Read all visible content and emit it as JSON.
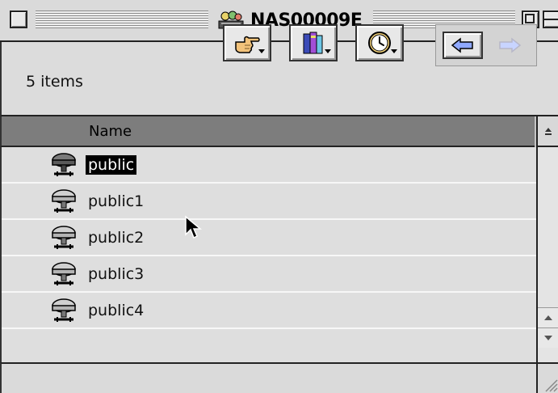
{
  "window": {
    "title": "NAS00009E"
  },
  "header": {
    "item_count": "5 items"
  },
  "toolbar": {
    "buttons": [
      {
        "icon": "pointing-hand-icon",
        "has_menu": true
      },
      {
        "icon": "books-icon",
        "has_menu": true
      },
      {
        "icon": "clock-icon",
        "has_menu": true
      }
    ],
    "nav": {
      "back_icon": "back-arrow-icon",
      "forward_icon": "forward-arrow-icon",
      "forward_enabled": false
    }
  },
  "columns": {
    "name_label": "Name"
  },
  "list": {
    "items": [
      {
        "name": "public",
        "selected": true
      },
      {
        "name": "public1",
        "selected": false
      },
      {
        "name": "public2",
        "selected": false
      },
      {
        "name": "public3",
        "selected": false
      },
      {
        "name": "public4",
        "selected": false
      }
    ]
  },
  "colors": {
    "selection": "#000000",
    "header_bg": "#7d7d7d",
    "list_bg": "#dedede",
    "nav_arrow": "#8fa8ff"
  }
}
